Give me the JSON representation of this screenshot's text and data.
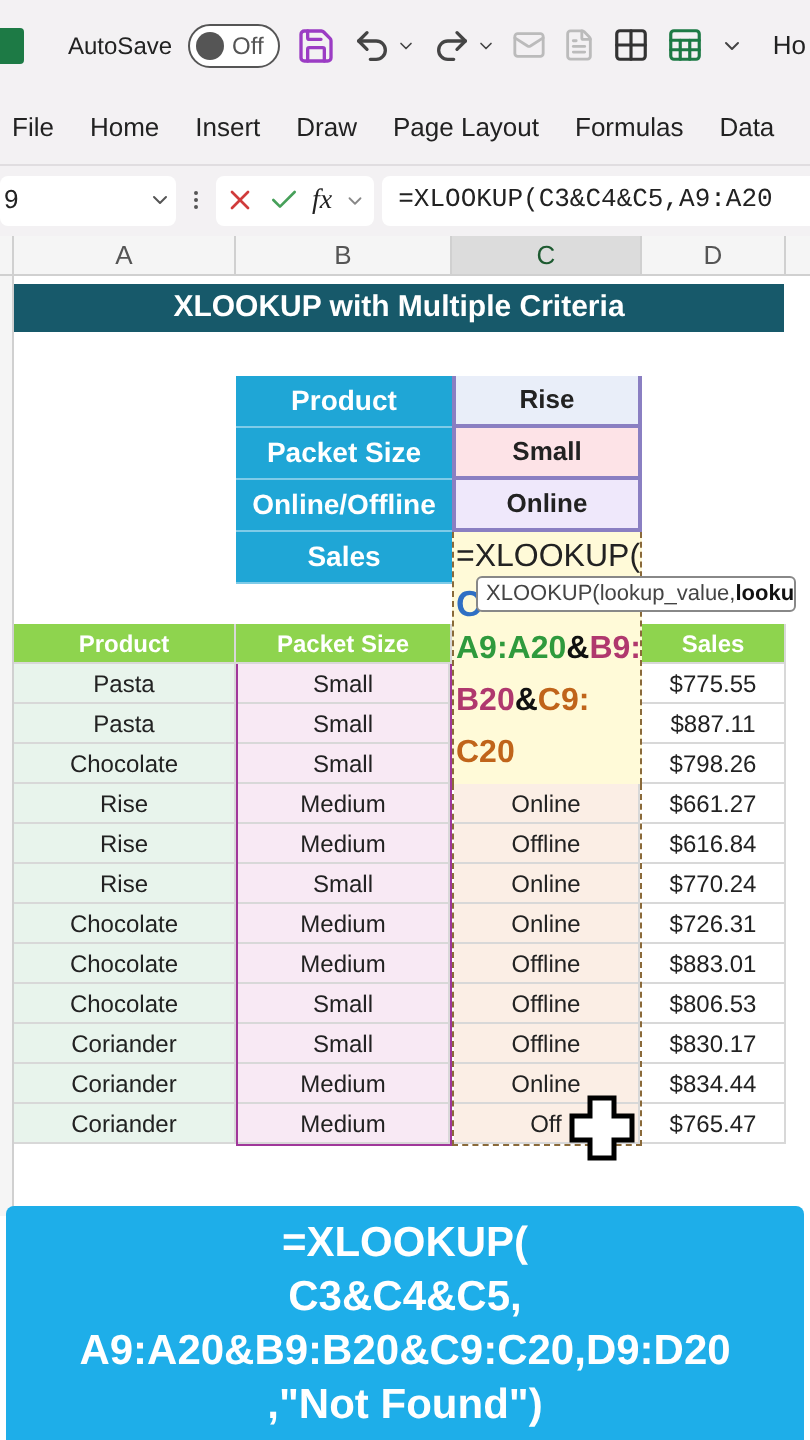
{
  "title_bar": {
    "autosave_label": "AutoSave",
    "autosave": {
      "on": false,
      "label": "Off"
    },
    "cut_tab": "Ho"
  },
  "ribbon_tabs": [
    {
      "label": "File",
      "selected": false
    },
    {
      "label": "Home",
      "selected": false
    },
    {
      "label": "Insert",
      "selected": false
    },
    {
      "label": "Draw",
      "selected": false
    },
    {
      "label": "Page Layout",
      "selected": false
    },
    {
      "label": "Formulas",
      "selected": false
    },
    {
      "label": "Data",
      "selected": false
    }
  ],
  "formula_bar": {
    "name_box": "9",
    "function_label": "fx",
    "formula": "=XLOOKUP(C3&C4&C5,A9:A20"
  },
  "columns": [
    {
      "label": "A",
      "selected": false
    },
    {
      "label": "B",
      "selected": false
    },
    {
      "label": "C",
      "selected": true
    },
    {
      "label": "D",
      "selected": false
    }
  ],
  "banner": "XLOOKUP with Multiple Criteria",
  "criteria": [
    {
      "label": "Product",
      "value": "Rise",
      "color": "#e9eef9"
    },
    {
      "label": "Packet Size",
      "value": "Small",
      "color": "#fde3e7"
    },
    {
      "label": "Online/Offline",
      "value": "Online",
      "color": "#efe8fb"
    },
    {
      "label": "Sales"
    }
  ],
  "edit_cell": {
    "first_line": "=XLOOKUP(",
    "hidden_start": "C",
    "lines": [
      [
        {
          "text": "A9:A20",
          "color": "#2f9a3d"
        },
        {
          "text": "&",
          "color": "#111111"
        },
        {
          "text": "B9:",
          "color": "#b0386e"
        }
      ],
      [
        {
          "text": "B20",
          "color": "#b0386e"
        },
        {
          "text": "&",
          "color": "#111111"
        },
        {
          "text": "C9:",
          "color": "#c0641a"
        }
      ],
      [
        {
          "text": "C20",
          "color": "#c0641a"
        }
      ]
    ]
  },
  "tooltip": {
    "text": "XLOOKUP(lookup_value, ",
    "bold": "looku"
  },
  "table": {
    "headers": [
      "Product",
      "Packet Size",
      "Sales"
    ],
    "rows": [
      {
        "product": "Pasta",
        "packet_size": "Small",
        "sales": "$775.55"
      },
      {
        "product": "Pasta",
        "packet_size": "Small",
        "sales": "$887.11"
      },
      {
        "product": "Chocolate",
        "packet_size": "Small",
        "sales": "$798.26"
      },
      {
        "product": "Rise",
        "packet_size": "Medium",
        "channel": "Online",
        "sales": "$661.27"
      },
      {
        "product": "Rise",
        "packet_size": "Medium",
        "channel": "Offline",
        "sales": "$616.84"
      },
      {
        "product": "Rise",
        "packet_size": "Small",
        "channel": "Online",
        "sales": "$770.24"
      },
      {
        "product": "Chocolate",
        "packet_size": "Medium",
        "channel": "Online",
        "sales": "$726.31"
      },
      {
        "product": "Chocolate",
        "packet_size": "Medium",
        "channel": "Offline",
        "sales": "$883.01"
      },
      {
        "product": "Chocolate",
        "packet_size": "Small",
        "channel": "Offline",
        "sales": "$806.53"
      },
      {
        "product": "Coriander",
        "packet_size": "Small",
        "channel": "Offline",
        "sales": "$830.17"
      },
      {
        "product": "Coriander",
        "packet_size": "Medium",
        "channel": "Online",
        "sales": "$834.44"
      },
      {
        "product": "Coriander",
        "packet_size": "Medium",
        "channel": "Off",
        "sales": "$765.47"
      }
    ]
  },
  "caption": [
    "=XLOOKUP(",
    "C3&C4&C5,",
    "A9:A20&B9:B20&C9:C20,D9:D20",
    ",\"Not Found\")"
  ]
}
